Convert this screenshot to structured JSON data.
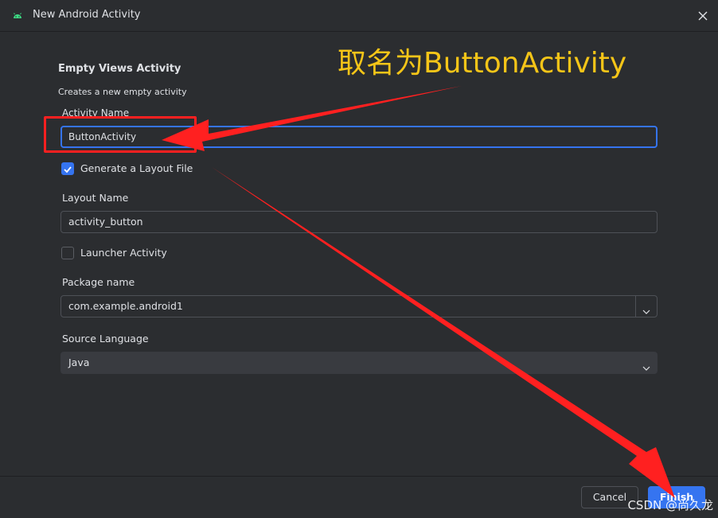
{
  "window": {
    "title": "New Android Activity",
    "icon": "android-icon",
    "close_icon": "close-icon"
  },
  "template": {
    "name": "Empty Views Activity",
    "description": "Creates a new empty activity"
  },
  "form": {
    "activity_name": {
      "label": "Activity Name",
      "value": "ButtonActivity"
    },
    "generate_layout": {
      "label": "Generate a Layout File",
      "checked": true
    },
    "layout_name": {
      "label": "Layout Name",
      "value": "activity_button"
    },
    "launcher_activity": {
      "label": "Launcher Activity",
      "checked": false
    },
    "package_name": {
      "label": "Package name",
      "value": "com.example.android1"
    },
    "source_language": {
      "label": "Source Language",
      "value": "Java"
    }
  },
  "footer": {
    "cancel_label": "Cancel",
    "finish_label": "Finish"
  },
  "annotation": {
    "text": "取名为ButtonActivity",
    "text_color": "#f5c518",
    "arrow_color": "#ff2020"
  },
  "watermark": "CSDN @尚久龙",
  "colors": {
    "background": "#2b2d30",
    "accent": "#3574f0",
    "text": "#dfe1e5"
  }
}
